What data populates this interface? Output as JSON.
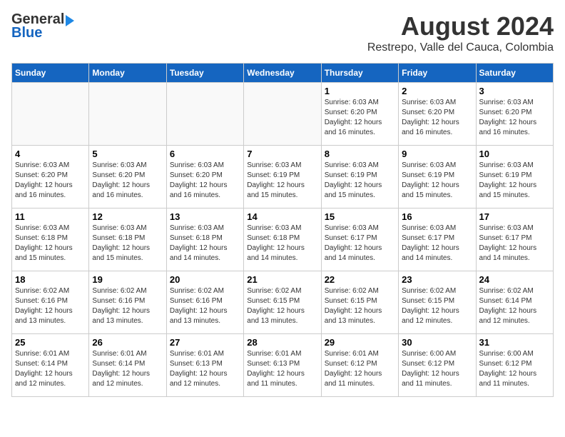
{
  "header": {
    "logo_general": "General",
    "logo_blue": "Blue",
    "month_year": "August 2024",
    "location": "Restrepo, Valle del Cauca, Colombia"
  },
  "days_of_week": [
    "Sunday",
    "Monday",
    "Tuesday",
    "Wednesday",
    "Thursday",
    "Friday",
    "Saturday"
  ],
  "weeks": [
    [
      {
        "day": "",
        "info": ""
      },
      {
        "day": "",
        "info": ""
      },
      {
        "day": "",
        "info": ""
      },
      {
        "day": "",
        "info": ""
      },
      {
        "day": "1",
        "info": "Sunrise: 6:03 AM\nSunset: 6:20 PM\nDaylight: 12 hours\nand 16 minutes."
      },
      {
        "day": "2",
        "info": "Sunrise: 6:03 AM\nSunset: 6:20 PM\nDaylight: 12 hours\nand 16 minutes."
      },
      {
        "day": "3",
        "info": "Sunrise: 6:03 AM\nSunset: 6:20 PM\nDaylight: 12 hours\nand 16 minutes."
      }
    ],
    [
      {
        "day": "4",
        "info": "Sunrise: 6:03 AM\nSunset: 6:20 PM\nDaylight: 12 hours\nand 16 minutes."
      },
      {
        "day": "5",
        "info": "Sunrise: 6:03 AM\nSunset: 6:20 PM\nDaylight: 12 hours\nand 16 minutes."
      },
      {
        "day": "6",
        "info": "Sunrise: 6:03 AM\nSunset: 6:20 PM\nDaylight: 12 hours\nand 16 minutes."
      },
      {
        "day": "7",
        "info": "Sunrise: 6:03 AM\nSunset: 6:19 PM\nDaylight: 12 hours\nand 15 minutes."
      },
      {
        "day": "8",
        "info": "Sunrise: 6:03 AM\nSunset: 6:19 PM\nDaylight: 12 hours\nand 15 minutes."
      },
      {
        "day": "9",
        "info": "Sunrise: 6:03 AM\nSunset: 6:19 PM\nDaylight: 12 hours\nand 15 minutes."
      },
      {
        "day": "10",
        "info": "Sunrise: 6:03 AM\nSunset: 6:19 PM\nDaylight: 12 hours\nand 15 minutes."
      }
    ],
    [
      {
        "day": "11",
        "info": "Sunrise: 6:03 AM\nSunset: 6:18 PM\nDaylight: 12 hours\nand 15 minutes."
      },
      {
        "day": "12",
        "info": "Sunrise: 6:03 AM\nSunset: 6:18 PM\nDaylight: 12 hours\nand 15 minutes."
      },
      {
        "day": "13",
        "info": "Sunrise: 6:03 AM\nSunset: 6:18 PM\nDaylight: 12 hours\nand 14 minutes."
      },
      {
        "day": "14",
        "info": "Sunrise: 6:03 AM\nSunset: 6:18 PM\nDaylight: 12 hours\nand 14 minutes."
      },
      {
        "day": "15",
        "info": "Sunrise: 6:03 AM\nSunset: 6:17 PM\nDaylight: 12 hours\nand 14 minutes."
      },
      {
        "day": "16",
        "info": "Sunrise: 6:03 AM\nSunset: 6:17 PM\nDaylight: 12 hours\nand 14 minutes."
      },
      {
        "day": "17",
        "info": "Sunrise: 6:03 AM\nSunset: 6:17 PM\nDaylight: 12 hours\nand 14 minutes."
      }
    ],
    [
      {
        "day": "18",
        "info": "Sunrise: 6:02 AM\nSunset: 6:16 PM\nDaylight: 12 hours\nand 13 minutes."
      },
      {
        "day": "19",
        "info": "Sunrise: 6:02 AM\nSunset: 6:16 PM\nDaylight: 12 hours\nand 13 minutes."
      },
      {
        "day": "20",
        "info": "Sunrise: 6:02 AM\nSunset: 6:16 PM\nDaylight: 12 hours\nand 13 minutes."
      },
      {
        "day": "21",
        "info": "Sunrise: 6:02 AM\nSunset: 6:15 PM\nDaylight: 12 hours\nand 13 minutes."
      },
      {
        "day": "22",
        "info": "Sunrise: 6:02 AM\nSunset: 6:15 PM\nDaylight: 12 hours\nand 13 minutes."
      },
      {
        "day": "23",
        "info": "Sunrise: 6:02 AM\nSunset: 6:15 PM\nDaylight: 12 hours\nand 12 minutes."
      },
      {
        "day": "24",
        "info": "Sunrise: 6:02 AM\nSunset: 6:14 PM\nDaylight: 12 hours\nand 12 minutes."
      }
    ],
    [
      {
        "day": "25",
        "info": "Sunrise: 6:01 AM\nSunset: 6:14 PM\nDaylight: 12 hours\nand 12 minutes."
      },
      {
        "day": "26",
        "info": "Sunrise: 6:01 AM\nSunset: 6:14 PM\nDaylight: 12 hours\nand 12 minutes."
      },
      {
        "day": "27",
        "info": "Sunrise: 6:01 AM\nSunset: 6:13 PM\nDaylight: 12 hours\nand 12 minutes."
      },
      {
        "day": "28",
        "info": "Sunrise: 6:01 AM\nSunset: 6:13 PM\nDaylight: 12 hours\nand 11 minutes."
      },
      {
        "day": "29",
        "info": "Sunrise: 6:01 AM\nSunset: 6:12 PM\nDaylight: 12 hours\nand 11 minutes."
      },
      {
        "day": "30",
        "info": "Sunrise: 6:00 AM\nSunset: 6:12 PM\nDaylight: 12 hours\nand 11 minutes."
      },
      {
        "day": "31",
        "info": "Sunrise: 6:00 AM\nSunset: 6:12 PM\nDaylight: 12 hours\nand 11 minutes."
      }
    ]
  ]
}
